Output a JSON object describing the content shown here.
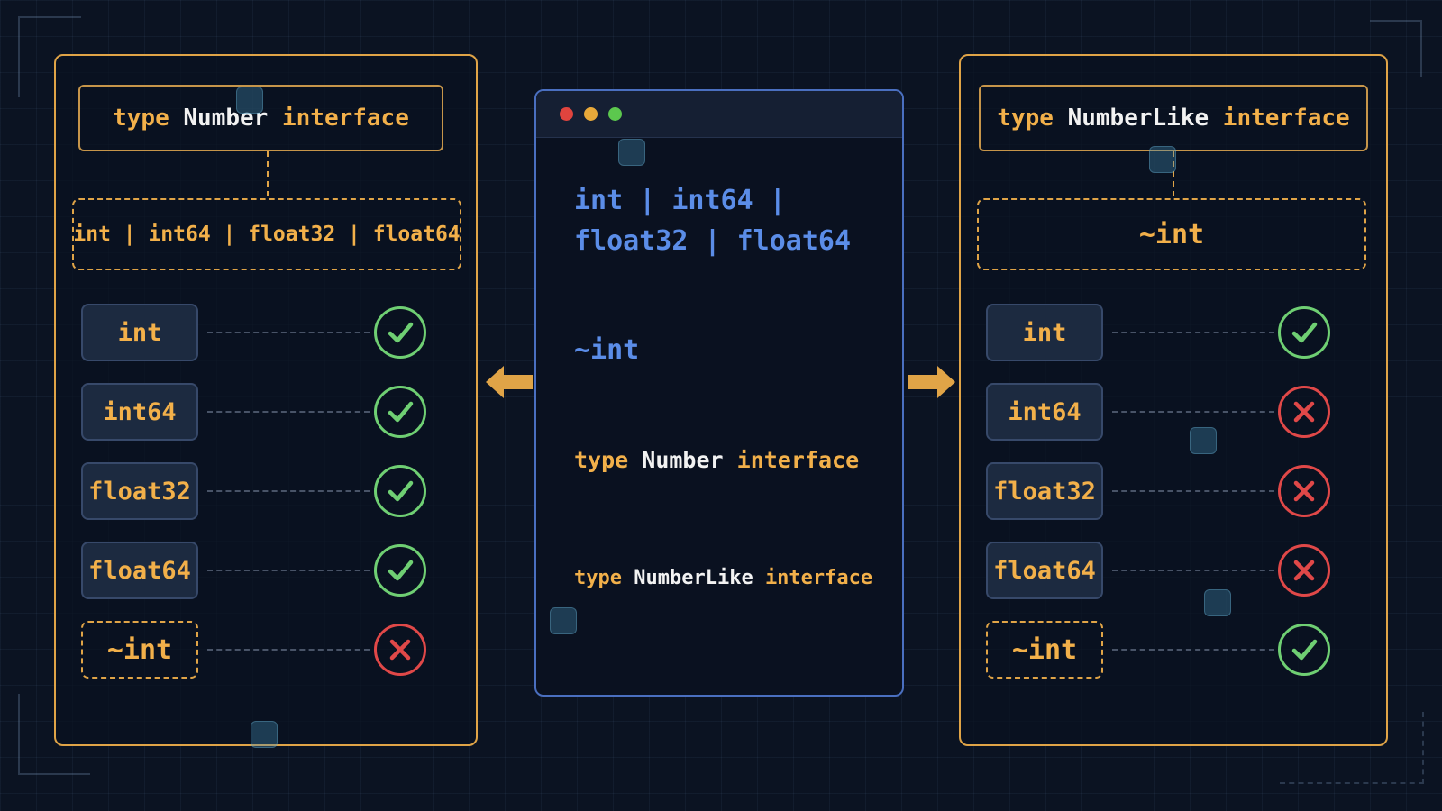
{
  "colors": {
    "accent": "#e0a447",
    "keyword": "#f2b04a",
    "code_blue": "#5b8de8",
    "ok": "#6fcf73",
    "no": "#e04848",
    "background": "#0b1322"
  },
  "left_panel": {
    "title": {
      "keyword": "type",
      "name": "Number",
      "kind": "interface"
    },
    "type_set": "int | int64 | float32 | float64",
    "rows": [
      {
        "label": "int",
        "result": "check",
        "approx": false
      },
      {
        "label": "int64",
        "result": "check",
        "approx": false
      },
      {
        "label": "float32",
        "result": "check",
        "approx": false
      },
      {
        "label": "float64",
        "result": "check",
        "approx": false
      },
      {
        "label": "~int",
        "result": "cross",
        "approx": true
      }
    ]
  },
  "right_panel": {
    "title": {
      "keyword": "type",
      "name": "NumberLike",
      "kind": "interface"
    },
    "type_set": "~int",
    "rows": [
      {
        "label": "int",
        "result": "check",
        "approx": false
      },
      {
        "label": "int64",
        "result": "cross",
        "approx": false
      },
      {
        "label": "float32",
        "result": "cross",
        "approx": false
      },
      {
        "label": "float64",
        "result": "cross",
        "approx": false
      },
      {
        "label": "~int",
        "result": "check",
        "approx": true
      }
    ]
  },
  "editor": {
    "window_dots": [
      "#e0443e",
      "#e8a93a",
      "#5cc84e"
    ],
    "line1": "int | int64 |",
    "line2": "float32 | float64",
    "line3": "~int",
    "line4": {
      "keyword": "type",
      "name": "Number",
      "kind": "interface"
    },
    "line5": {
      "keyword": "type",
      "name": "NumberLike",
      "kind": "interface"
    }
  }
}
